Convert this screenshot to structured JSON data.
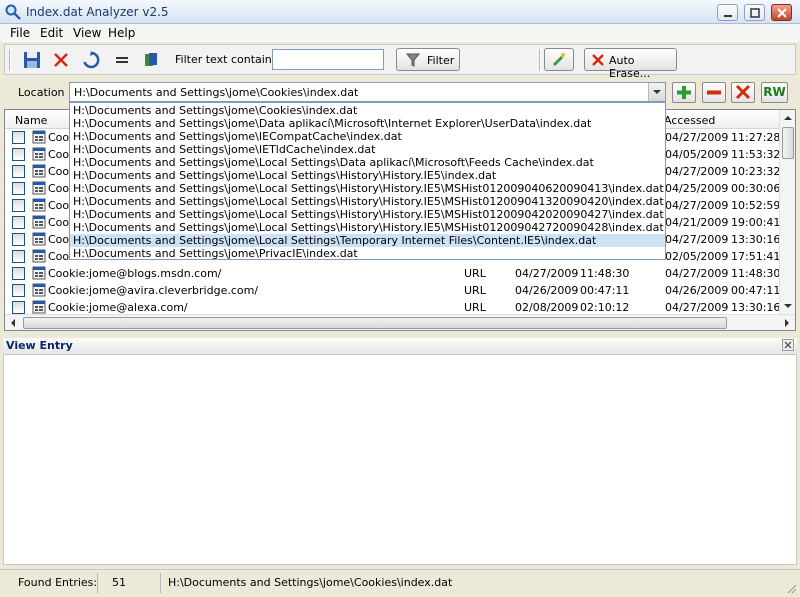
{
  "window": {
    "title": "Index.dat Analyzer v2.5"
  },
  "menu": [
    "File",
    "Edit",
    "View",
    "Help"
  ],
  "toolbar": {
    "filter_label": "Filter text contain",
    "filter_value": "",
    "filter_button": "Filter",
    "auto_erase_button": "Auto Erase..."
  },
  "location": {
    "label": "Location",
    "value": "H:\\Documents and Settings\\jome\\Cookies\\index.dat",
    "rw_button": "RW",
    "dropdown": [
      "H:\\Documents and Settings\\jome\\Cookies\\index.dat",
      "H:\\Documents and Settings\\jome\\Data aplikací\\Microsoft\\Internet Explorer\\UserData\\index.dat",
      "H:\\Documents and Settings\\jome\\IECompatCache\\index.dat",
      "H:\\Documents and Settings\\jome\\IETldCache\\index.dat",
      "H:\\Documents and Settings\\jome\\Local Settings\\Data aplikací\\Microsoft\\Feeds Cache\\index.dat",
      "H:\\Documents and Settings\\jome\\Local Settings\\History\\History.IE5\\index.dat",
      "H:\\Documents and Settings\\jome\\Local Settings\\History\\History.IE5\\MSHist012009040620090413\\index.dat",
      "H:\\Documents and Settings\\jome\\Local Settings\\History\\History.IE5\\MSHist012009041320090420\\index.dat",
      "H:\\Documents and Settings\\jome\\Local Settings\\History\\History.IE5\\MSHist012009042020090427\\index.dat",
      "H:\\Documents and Settings\\jome\\Local Settings\\History\\History.IE5\\MSHist012009042720090428\\index.dat",
      "H:\\Documents and Settings\\jome\\Local Settings\\Temporary Internet Files\\Content.IE5\\index.dat",
      "H:\\Documents and Settings\\jome\\PrivacIE\\index.dat"
    ],
    "selected_index": 10
  },
  "list": {
    "columns": {
      "name": "Name",
      "accessed": "Accessed"
    },
    "rows": [
      {
        "name": "Cooki",
        "type": "",
        "date1": "",
        "time1": "",
        "date2": "04/27/2009",
        "time2": "11:27:28"
      },
      {
        "name": "Cooki",
        "type": "",
        "date1": "",
        "time1": "",
        "date2": "04/05/2009",
        "time2": "11:53:32"
      },
      {
        "name": "Cooki",
        "type": "",
        "date1": "",
        "time1": "",
        "date2": "04/27/2009",
        "time2": "10:23:32"
      },
      {
        "name": "Cooki",
        "type": "",
        "date1": "",
        "time1": "",
        "date2": "04/25/2009",
        "time2": "00:30:06"
      },
      {
        "name": "Cooki",
        "type": "",
        "date1": "",
        "time1": "",
        "date2": "04/27/2009",
        "time2": "10:52:59"
      },
      {
        "name": "Cooki",
        "type": "",
        "date1": "",
        "time1": "",
        "date2": "04/21/2009",
        "time2": "19:00:41"
      },
      {
        "name": "Cooki",
        "type": "",
        "date1": "",
        "time1": "",
        "date2": "04/27/2009",
        "time2": "13:30:16"
      },
      {
        "name": "Cooki",
        "type": "",
        "date1": "",
        "time1": "",
        "date2": "02/05/2009",
        "time2": "17:51:41"
      },
      {
        "name": "Cookie:jome@blogs.msdn.com/",
        "type": "URL",
        "date1": "04/27/2009",
        "time1": "11:48:30",
        "date2": "04/27/2009",
        "time2": "11:48:30"
      },
      {
        "name": "Cookie:jome@avira.cleverbridge.com/",
        "type": "URL",
        "date1": "04/26/2009",
        "time1": "00:47:11",
        "date2": "04/26/2009",
        "time2": "00:47:11"
      },
      {
        "name": "Cookie:jome@alexa.com/",
        "type": "URL",
        "date1": "02/08/2009",
        "time1": "02:10:12",
        "date2": "04/27/2009",
        "time2": "13:30:16"
      }
    ]
  },
  "view_entry": {
    "title": "View Entry"
  },
  "status": {
    "found_label": "Found Entries:",
    "found_count": "51",
    "path": "H:\\Documents and Settings\\jome\\Cookies\\index.dat"
  }
}
